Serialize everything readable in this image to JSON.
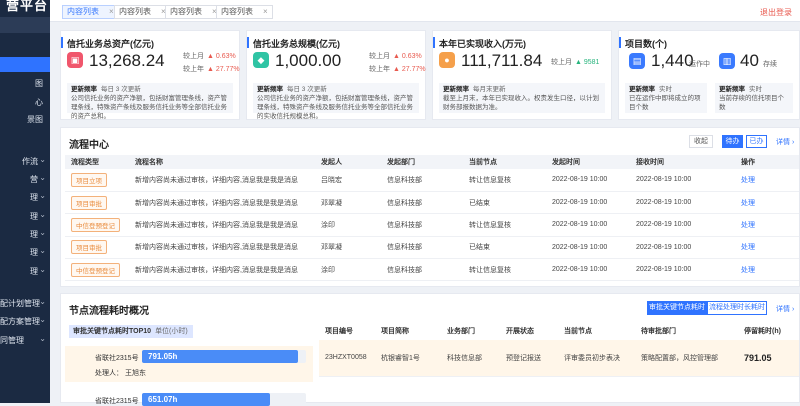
{
  "sidebar": {
    "brand": "营平台",
    "items": [
      {
        "label": "图",
        "chev": ""
      },
      {
        "label": "心",
        "chev": ""
      },
      {
        "label": "景图",
        "chev": ""
      },
      {
        "label": "作流",
        "chev": "⌄"
      },
      {
        "label": "营",
        "chev": "⌄"
      },
      {
        "label": "理",
        "chev": "⌄"
      },
      {
        "label": "理",
        "chev": "⌄"
      },
      {
        "label": "理",
        "chev": "⌄"
      },
      {
        "label": "理",
        "chev": "⌄"
      },
      {
        "label": "理",
        "chev": "⌄"
      },
      {
        "label": "配计划管理",
        "chev": "⌄"
      },
      {
        "label": "配方案管理",
        "chev": "⌄"
      },
      {
        "label": "同管理",
        "chev": "⌄"
      }
    ]
  },
  "topbar": {
    "tabs": [
      {
        "label": "内容列表",
        "close": "×"
      },
      {
        "label": "内容列表",
        "close": "×"
      },
      {
        "label": "内容列表",
        "close": "×"
      },
      {
        "label": "内容列表",
        "close": "×"
      }
    ],
    "logout": "退出登录"
  },
  "cards": [
    {
      "title": "信托业务总资产(亿元)",
      "value": "13,268.24",
      "icon_color": "#f0566c",
      "icon": "▣",
      "cmp1_label": "较上月",
      "cmp1_pct": "▲ 0.63%",
      "cmp2_label": "较上年",
      "cmp2_pct": "▲ 27.77%",
      "note_key": "更新频率",
      "note_freq": "每日 3 次更新",
      "note_text": "公司信托业务的资产净额，包括财富管理条线，资产管理条线，特殊资产条线及服务信托业务等全部信托业务的资产总和。"
    },
    {
      "title": "信托业务总规模(亿元)",
      "value": "1,000.00",
      "icon_color": "#2fc4a4",
      "icon": "◆",
      "cmp1_label": "较上月",
      "cmp1_pct": "▲ 0.63%",
      "cmp2_label": "较上年",
      "cmp2_pct": "▲ 27.77%",
      "note_key": "更新频率",
      "note_freq": "每日 3 次更新",
      "note_text": "公司信托业务的资产净额，包括财富管理条线，资产管理条线，特殊资产条线及服务信托业务等全部信托业务的实收信托规模总和。"
    },
    {
      "title": "本年已实现收入(万元)",
      "value": "111,711.84",
      "icon_color": "#f5a04b",
      "icon": "●",
      "cmp1_label": "较上月",
      "cmp1_pct": "▲ 9581",
      "cmp2_label": "",
      "cmp2_pct": "",
      "note_key": "更新频率",
      "note_freq": "每月末更新",
      "note_text": "截至上月末，本年已实现收入。权责发生口径，以计划财务部报数据为准。"
    },
    {
      "title": "项目数(个)",
      "value": "1,440",
      "icon_color": "#3a7afe",
      "icon": "▤",
      "sub_label": "运作中",
      "cmp1_label": "",
      "cmp1_pct": "",
      "cmp2_label": "",
      "cmp2_pct": "",
      "note_key": "更新频率",
      "note_freq": "实时",
      "note_text": "已在运作中即将成立的项目个数"
    },
    {
      "title": "",
      "value": "40",
      "icon_color": "#3a7afe",
      "icon": "▥",
      "sub_label": "存续",
      "note_key": "更新频率",
      "note_freq": "实时",
      "note_text": "当前存续的信托项目个数"
    }
  ],
  "flow": {
    "title": "流程中心",
    "btn_collect": "收起",
    "btn_todo": "待办",
    "btn_done": "已办",
    "more": "详情 ›",
    "headers": [
      "流程类型",
      "流程名称",
      "发起人",
      "发起部门",
      "当前节点",
      "发起时间",
      "接收时间",
      "操作"
    ],
    "rows": [
      [
        "项目立项",
        "新增内容尚未通过审核，详细内容,消息我是我是消息",
        "吕晓宏",
        "信息科技部",
        "转让信息复核",
        "2022-08-19  10:00",
        "2022-08-19  10:00",
        "处理"
      ],
      [
        "项目审批",
        "新增内容尚未通过审核，详细内容,消息我是我是消息",
        "邓翠凝",
        "信息科技部",
        "已结束",
        "2022-08-19  10:00",
        "2022-08-19  10:00",
        "处理"
      ],
      [
        "中信登预登记",
        "新增内容尚未通过审核，详细内容,消息我是我是消息",
        "涂印",
        "信息科技部",
        "转让信息复核",
        "2022-08-19  10:00",
        "2022-08-19  10:00",
        "处理"
      ],
      [
        "项目审批",
        "新增内容尚未通过审核，详细内容,消息我是我是消息",
        "邓翠凝",
        "信息科技部",
        "已结束",
        "2022-08-19  10:00",
        "2022-08-19  10:00",
        "处理"
      ],
      [
        "中信登预登记",
        "新增内容尚未通过审核，详细内容,消息我是我是消息",
        "涂印",
        "信息科技部",
        "转让信息复核",
        "2022-08-19  10:00",
        "2022-08-19  10:00",
        "处理"
      ]
    ]
  },
  "node": {
    "title": "节点流程耗时概况",
    "btn_node": "审批关键节点耗时",
    "btn_flow": "流程处理时长耗时",
    "sub_title": "审批关键节点耗时TOP10",
    "sub_unit": "单位(小时)",
    "bars": [
      {
        "name": "省联社2315号",
        "value": "791.05h",
        "pct": 0.95,
        "handler_label": "处理人：",
        "handler": "王旭东"
      },
      {
        "name": "省联社2315号",
        "value": "651.07h",
        "pct": 0.78
      }
    ],
    "headers": [
      "项目编号",
      "项目简称",
      "业务部门",
      "开展状态",
      "当前节点",
      "待审批部门",
      "停留耗时(h)"
    ],
    "row": [
      "23HZXT0058",
      "杭银睿智1号",
      "科技信息部",
      "预登记报送",
      "评审委员初步表决",
      "策略配置部，风控管理部",
      "791.05"
    ]
  }
}
